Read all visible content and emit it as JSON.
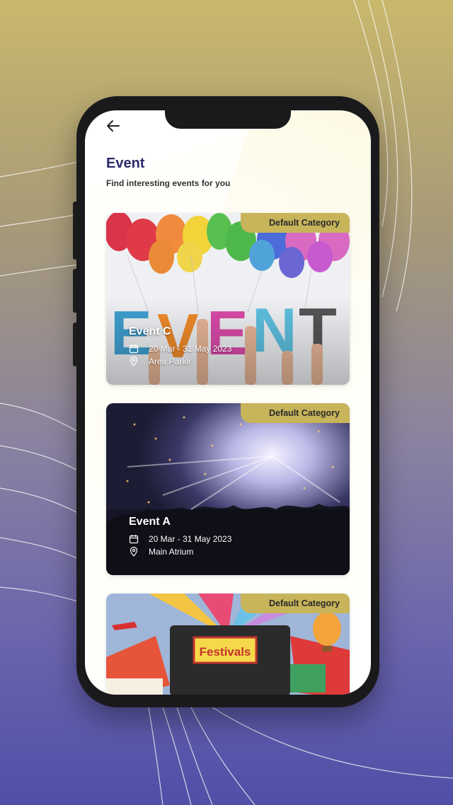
{
  "header": {
    "title": "Event",
    "subtitle": "Find interesting events for you"
  },
  "events": [
    {
      "category": "Default Category",
      "name": "Event C",
      "dates": "20 Mar - 31 May 2023",
      "location": "Area Parkir"
    },
    {
      "category": "Default Category",
      "name": "Event A",
      "dates": "20 Mar - 31 May 2023",
      "location": "Main Atrium"
    },
    {
      "category": "Default Category",
      "name": "",
      "dates": "",
      "location": ""
    }
  ],
  "artwork_text": {
    "event_letters": "EVENT",
    "festival_sign": "Festivals"
  },
  "colors": {
    "badge": "#c8b45a",
    "title": "#2e2a6b",
    "bg_top": "#c9b86c",
    "bg_bottom": "#4f4fa7"
  }
}
